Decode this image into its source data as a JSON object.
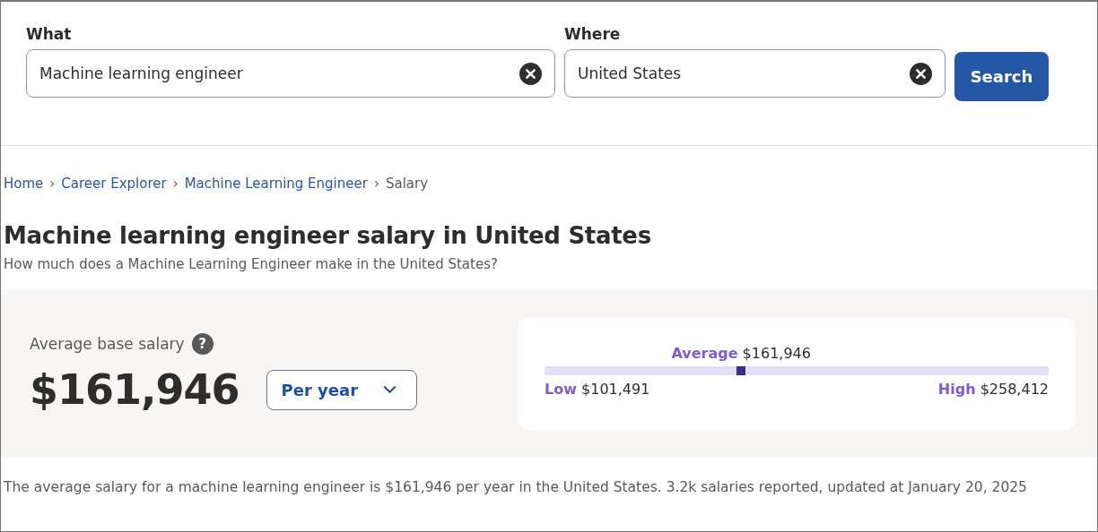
{
  "search": {
    "what": {
      "label": "What",
      "value": "Machine learning engineer"
    },
    "where": {
      "label": "Where",
      "value": "United States"
    },
    "button": "Search"
  },
  "breadcrumb": [
    {
      "label": "Home",
      "link": true
    },
    {
      "label": "Career Explorer",
      "link": true
    },
    {
      "label": "Machine Learning Engineer",
      "link": true
    },
    {
      "label": "Salary",
      "link": false
    }
  ],
  "separator": "›",
  "title": "Machine learning engineer salary in United States",
  "subtitle": "How much does a Machine Learning Engineer make in the United States?",
  "salary": {
    "label": "Average base salary",
    "help": "?",
    "amount": "$161,946",
    "period": "Per year",
    "range": {
      "average_label": "Average",
      "average": "$161,946",
      "level": 0.39,
      "low_label": "Low",
      "low": "$101,491",
      "high_label": "High",
      "high": "$258,412"
    }
  },
  "footnote": "The average salary for a machine learning engineer is $161,946 per year in the United States.  3.2k salaries reported, updated at January 20, 2025"
}
